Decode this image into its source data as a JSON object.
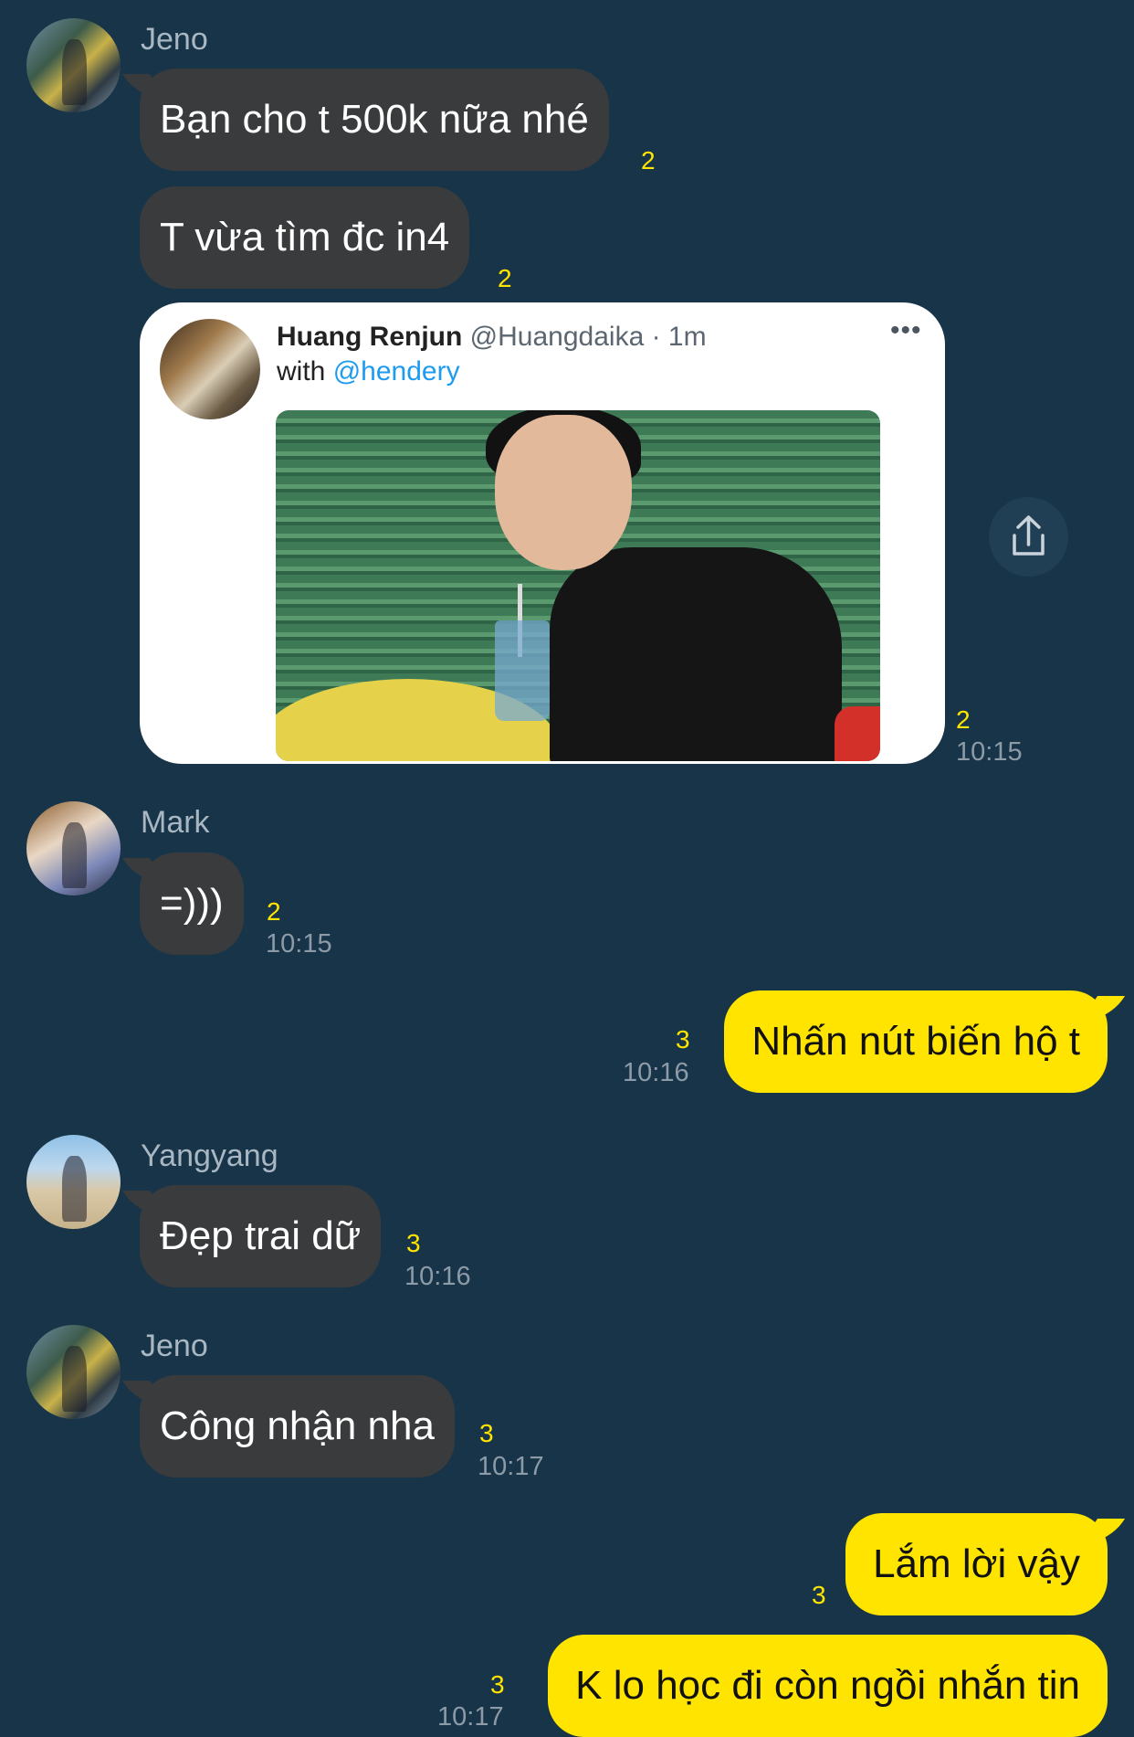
{
  "messages": [
    {
      "sender": "Jeno",
      "text": "Bạn cho t 500k nữa nhé",
      "unread": "2"
    },
    {
      "text": "T vừa tìm đc in4",
      "unread": "2"
    },
    {
      "tweet": {
        "name": "Huang Renjun",
        "handle": "@Huangdaika · 1m",
        "with": "with",
        "mention": "@hendery",
        "more": "•••"
      },
      "unread": "2",
      "time": "10:15"
    },
    {
      "sender": "Mark",
      "text": "=)))",
      "unread": "2",
      "time": "10:15"
    },
    {
      "outgoing": true,
      "text": "Nhấn nút biến hộ t",
      "unread": "3",
      "time": "10:16"
    },
    {
      "sender": "Yangyang",
      "text": "Đẹp trai dữ",
      "unread": "3",
      "time": "10:16"
    },
    {
      "sender": "Jeno",
      "text": "Công nhận nha",
      "unread": "3",
      "time": "10:17"
    },
    {
      "outgoing": true,
      "text": "Lắm lời vậy",
      "unread": "3"
    },
    {
      "outgoing": true,
      "text": "K lo học đi còn ngồi nhắn tin",
      "unread": "3",
      "time": "10:17"
    }
  ],
  "icons": {
    "share": "share-icon",
    "avatar": "avatar"
  },
  "colors": {
    "background": "#173449",
    "incoming_bubble": "#3a3b3d",
    "outgoing_bubble": "#ffe400",
    "unread": "#ffe400",
    "mention": "#1d9bf0"
  }
}
